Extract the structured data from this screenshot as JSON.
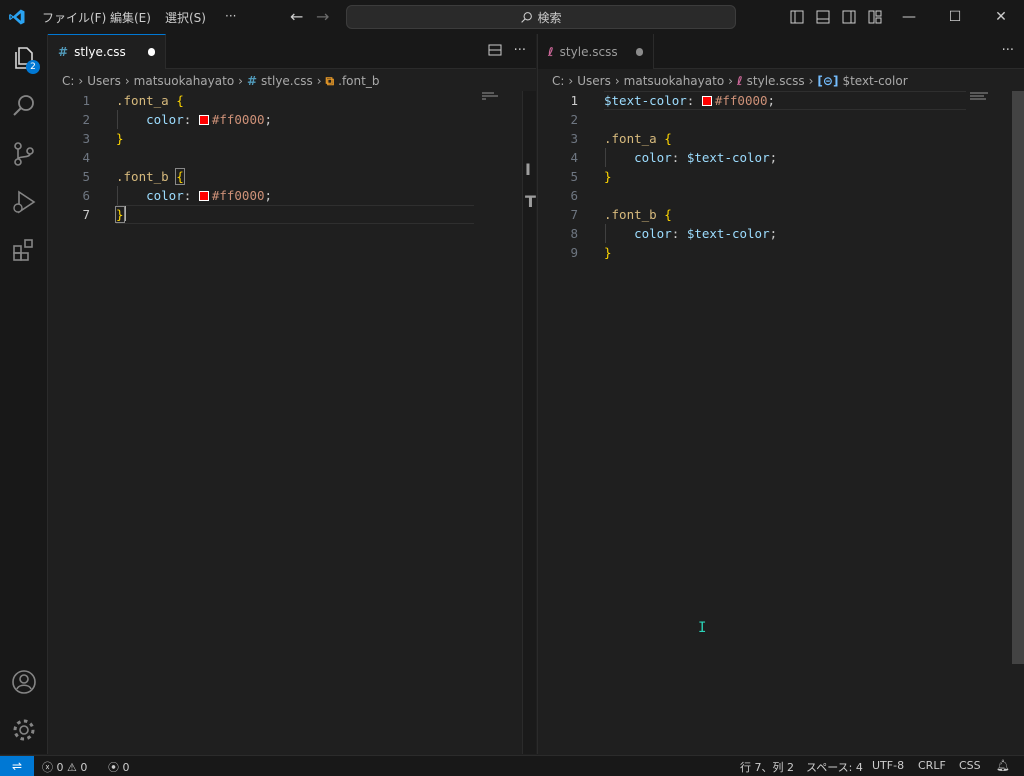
{
  "menu": {
    "file": "ファイル(F)",
    "edit": "編集(E)",
    "selection": "選択(S)",
    "more": "···"
  },
  "search": {
    "label": "検索"
  },
  "activity": {
    "explorer_badge": "2"
  },
  "left": {
    "tab_label": "stlye.css",
    "tab_icon": "#",
    "breadcrumb": [
      "C:",
      "Users",
      "matsuokahayato",
      "stlye.css",
      ".font_b"
    ],
    "line_numbers": [
      "1",
      "2",
      "3",
      "4",
      "5",
      "6",
      "7"
    ],
    "code": {
      "l1_sel": ".font_a",
      "l1_brace": "{",
      "l2_prop": "color",
      "l2_colon": ":",
      "l2_val": "#ff0000",
      "l2_semi": ";",
      "l3_brace": "}",
      "l5_sel": ".font_b",
      "l5_brace": "{",
      "l6_prop": "color",
      "l6_colon": ":",
      "l6_val": "#ff0000",
      "l6_semi": ";",
      "l7_brace": "}"
    },
    "current_line": "7"
  },
  "right": {
    "tab_label": "style.scss",
    "breadcrumb": [
      "C:",
      "Users",
      "matsuokahayato",
      "style.scss",
      "$text-color"
    ],
    "line_numbers": [
      "1",
      "2",
      "3",
      "4",
      "5",
      "6",
      "7",
      "8",
      "9"
    ],
    "code": {
      "l1_var": "$text-color",
      "l1_colon": ":",
      "l1_val": "#ff0000",
      "l1_semi": ";",
      "l3_sel": ".font_a",
      "l3_brace": "{",
      "l4_prop": "color",
      "l4_colon": ":",
      "l4_val": "$text-color",
      "l4_semi": ";",
      "l5_brace": "}",
      "l7_sel": ".font_b",
      "l7_brace": "{",
      "l8_prop": "color",
      "l8_colon": ":",
      "l8_val": "$text-color",
      "l8_semi": ";",
      "l9_brace": "}"
    },
    "current_line": "1"
  },
  "status": {
    "errors": "0",
    "warnings": "0",
    "ports": "0",
    "position": "行 7、列 2",
    "spaces": "スペース: 4",
    "encoding": "UTF-8",
    "eol": "CRLF",
    "language": "CSS"
  },
  "colors": {
    "accent": "#0078d4",
    "swatch": "#ff0000"
  }
}
